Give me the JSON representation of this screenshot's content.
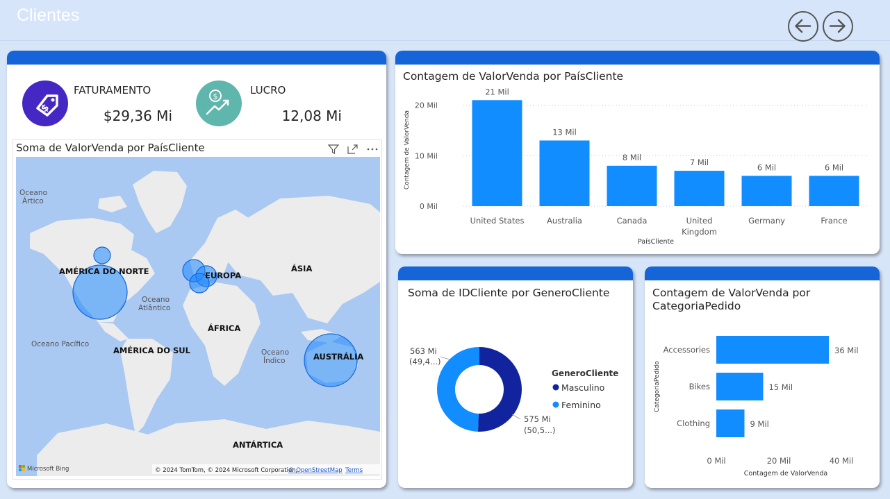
{
  "page": {
    "title": "Clientes"
  },
  "kpis": {
    "faturamento": {
      "label": "FATURAMENTO",
      "value": "$29,36 Mi"
    },
    "lucro": {
      "label": "LUCRO",
      "value": "12,08 Mi"
    }
  },
  "map": {
    "title": "Soma de ValorVenda por PaísCliente",
    "labels": {
      "ocean_arctic_1": "Oceano",
      "ocean_arctic_2": "Ártico",
      "north_america": "AMÉRICA DO NORTE",
      "europe": "EUROPA",
      "asia": "ÁSIA",
      "ocean_atlantic_1": "Oceano",
      "ocean_atlantic_2": "Atlântico",
      "africa": "ÁFRICA",
      "ocean_pacific": "Oceano Pacífico",
      "south_america": "AMÉRICA DO SUL",
      "ocean_indian_1": "Oceano",
      "ocean_indian_2": "Índico",
      "australia": "AUSTRÁLIA",
      "antarctica": "ANTÁRTICA"
    },
    "bing_logo": "Microsoft Bing",
    "attribution": "© 2024 TomTom, © 2024 Microsoft Corporation,",
    "osm_link": "© OpenStreetMap",
    "terms_link": "Terms",
    "icons": [
      "filter-icon",
      "focus-mode-icon",
      "more-options-icon"
    ]
  },
  "chart_country": {
    "title": "Contagem de ValorVenda por PaísCliente",
    "chart_data": {
      "type": "bar",
      "categories": [
        "United States",
        "Australia",
        "Canada",
        "United Kingdom",
        "Germany",
        "France"
      ],
      "values": [
        21000,
        13000,
        8000,
        7000,
        6000,
        6000
      ],
      "data_labels": [
        "21 Mil",
        "13 Mil",
        "8 Mil",
        "7 Mil",
        "6 Mil",
        "6 Mil"
      ],
      "xlabel": "PaísCliente",
      "ylabel": "Contagem de ValorVenda",
      "yticks": [
        0,
        10000,
        20000
      ],
      "ytick_labels": [
        "0 Mil",
        "10 Mil",
        "20 Mil"
      ],
      "ylim": [
        0,
        22000
      ],
      "grid": true,
      "color": "#118dff"
    }
  },
  "chart_gender": {
    "title": "Soma de IDCliente por GeneroCliente",
    "chart_data": {
      "type": "pie",
      "donut": true,
      "categories": [
        "Masculino",
        "Feminino"
      ],
      "values": [
        575,
        563
      ],
      "value_labels": [
        "575 Mi",
        "563 Mi"
      ],
      "percent_labels": [
        "(50,5...)",
        "(49,4...)"
      ],
      "legend_title": "GeneroCliente",
      "legend_position": "right",
      "colors": [
        "#12239e",
        "#118dff"
      ]
    }
  },
  "chart_category": {
    "title_line1": "Contagem de ValorVenda por",
    "title_line2": "CategoriaPedido",
    "chart_data": {
      "type": "bar",
      "orientation": "horizontal",
      "categories": [
        "Accessories",
        "Bikes",
        "Clothing"
      ],
      "values": [
        36000,
        15000,
        9000
      ],
      "data_labels": [
        "36 Mil",
        "15 Mil",
        "9 Mil"
      ],
      "xlabel": "Contagem de ValorVenda",
      "ylabel": "CategoriaPedido",
      "xticks": [
        0,
        20000,
        40000
      ],
      "xtick_labels": [
        "0 Mil",
        "20 Mil",
        "40 Mil"
      ],
      "xlim": [
        0,
        42000
      ],
      "color": "#118dff"
    }
  }
}
